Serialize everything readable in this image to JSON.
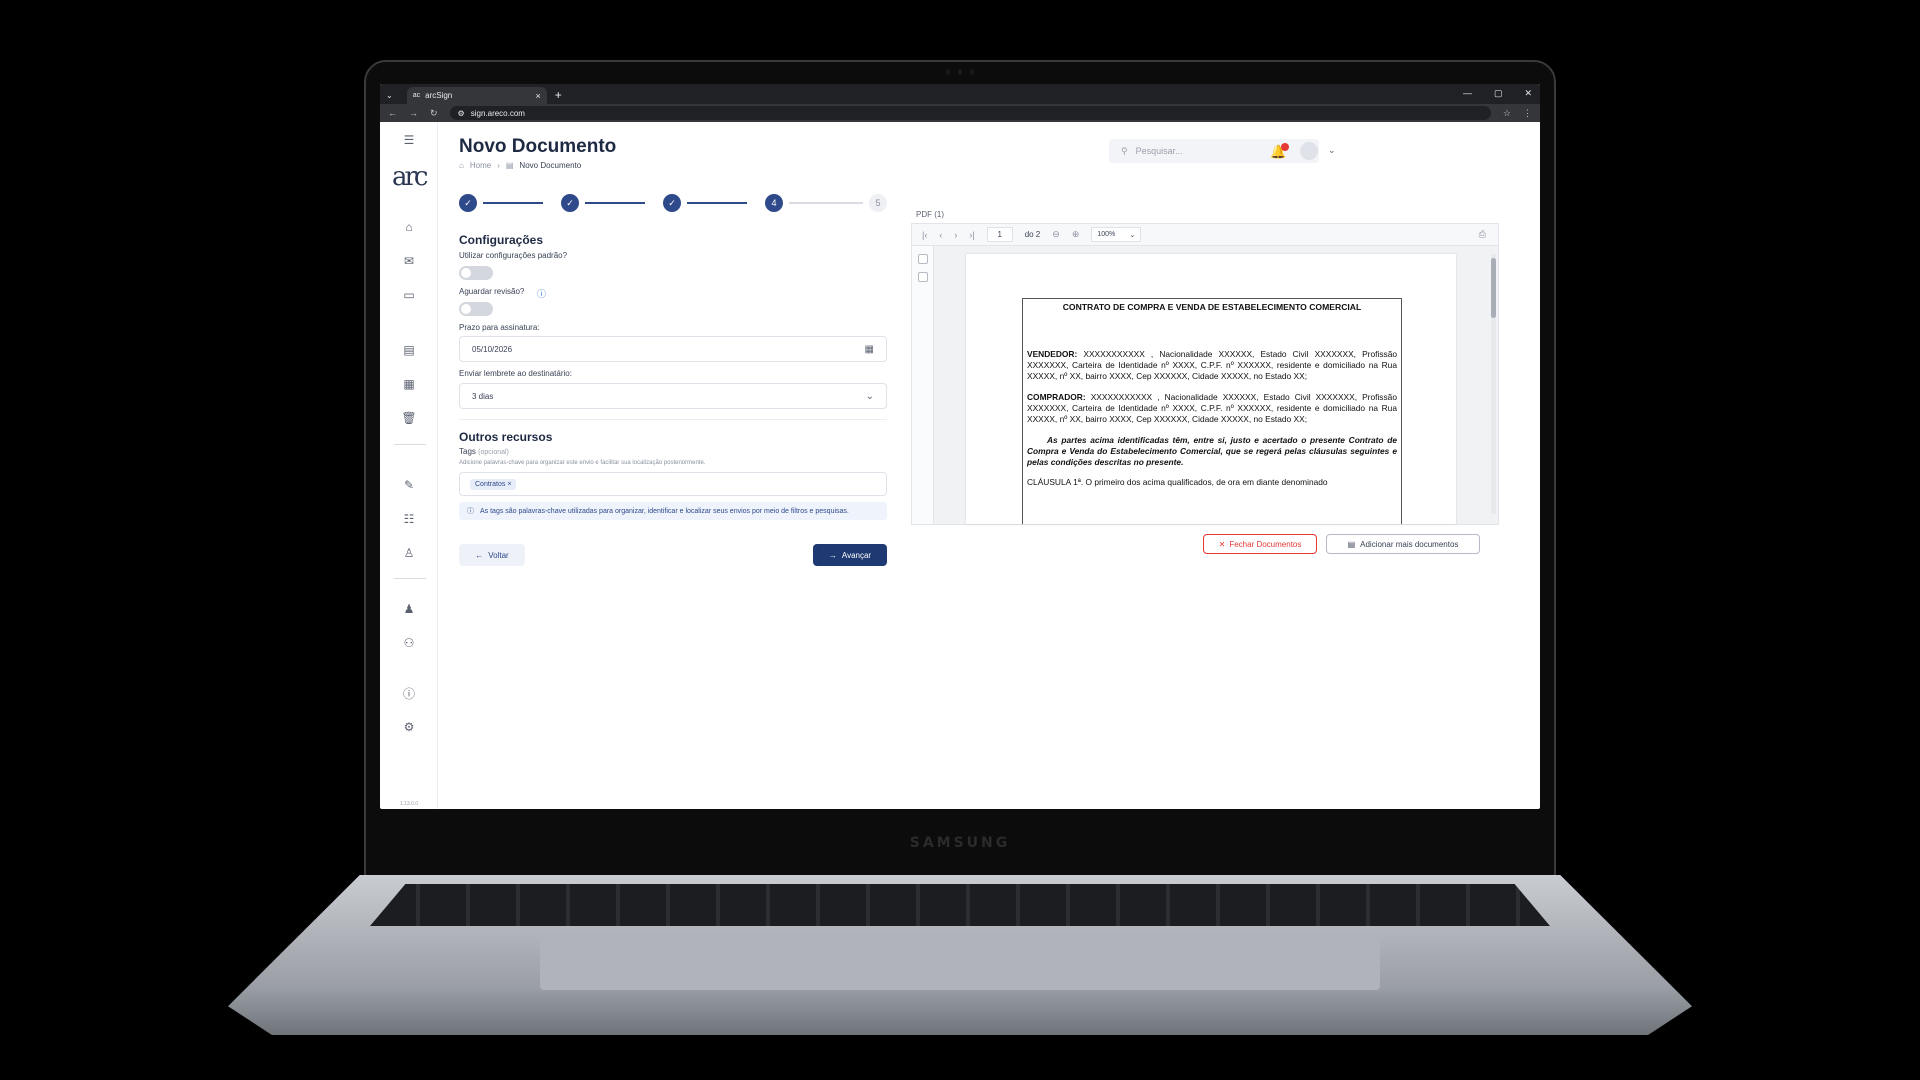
{
  "browser": {
    "tab_title": "arcSign",
    "tab_close": "×",
    "new_tab": "+",
    "url": "sign.areco.com",
    "window_controls": [
      "—",
      "▢",
      "✕"
    ]
  },
  "sidebar": {
    "logo": "arc",
    "version": "1.13.0.0"
  },
  "header": {
    "title": "Novo Documento",
    "breadcrumb": [
      "Home",
      "Novo Documento"
    ],
    "search_placeholder": "Pesquisar..."
  },
  "stepper": {
    "steps": [
      "✓",
      "✓",
      "✓",
      "4",
      "5"
    ],
    "current_step": 4,
    "total_steps": 5
  },
  "configuracoes": {
    "title": "Configurações",
    "default_config_label": "Utilizar configurações padrão?",
    "await_review_label": "Aguardar revisão?",
    "deadline_label": "Prazo para assinatura:",
    "deadline_value": "05/10/2026",
    "reminder_label": "Enviar lembrete ao destinatário:",
    "reminder_value": "3 dias"
  },
  "outros": {
    "title": "Outros recursos",
    "tags_label": "Tags",
    "tags_optional": "(opcional)",
    "tags_hint": "Adicione palavras-chave para organizar este envio e facilitar sua localização posteriormente.",
    "tag_chip": "Contratos",
    "info_text": "As tags são palavras-chave utilizadas para organizar, identificar e localizar seus envios por meio de filtros e pesquisas."
  },
  "actions": {
    "back": "Voltar",
    "next": "Avançar",
    "close_docs": "Fechar Documentos",
    "add_docs": "Adicionar mais documentos"
  },
  "pdf": {
    "label": "PDF (1)",
    "page": "1",
    "of_pages": "do 2",
    "zoom": "100%",
    "doc_title": "CONTRATO DE COMPRA E VENDA DE ESTABELECIMENTO COMERCIAL",
    "vendedor_label": "VENDEDOR:",
    "vendedor_text": "XXXXXXXXXXX , Nacionalidade XXXXXX, Estado Civil XXXXXXX, Profissão XXXXXXX, Carteira de Identidade nº XXXX, C.P.F. nº XXXXXX, residente e domiciliado na Rua XXXXX, nº XX, bairro XXXX, Cep XXXXXX, Cidade XXXXX, no Estado XX;",
    "comprador_label": "COMPRADOR:",
    "comprador_text": "XXXXXXXXXXX , Nacionalidade XXXXXX, Estado Civil XXXXXXX, Profissão XXXXXXX, Carteira de Identidade nº XXXX, C.P.F. nº XXXXXX, residente e domiciliado na Rua XXXXX, nº XX, bairro XXXX, Cep XXXXXX, Cidade XXXXX, no Estado XX;",
    "partes_text": "As partes acima identificadas têm, entre si, justo e acertado o presente Contrato de Compra e Venda do Estabelecimento Comercial, que se regerá pelas cláusulas seguintes e pelas condições descritas no presente.",
    "clausula_text": "CLÁUSULA 1ª. O primeiro dos acima qualificados, de ora em diante denominado"
  },
  "device": {
    "brand": "SAMSUNG"
  }
}
